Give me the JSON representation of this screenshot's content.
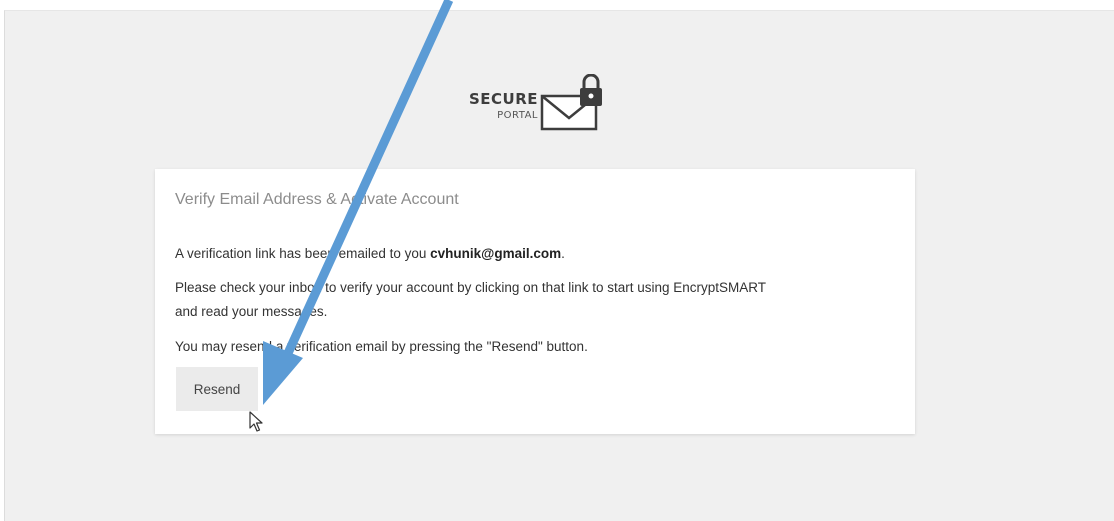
{
  "logo": {
    "word": "SECURE",
    "sub": "PORTAL"
  },
  "card": {
    "title": "Verify Email Address & Activate Account",
    "line1_prefix": "A verification link has been emailed to you ",
    "line1_email": "cvhunik@gmail.com",
    "line1_suffix": ".",
    "line2a": "Please check your inbox to verify your account by clicking on that link to start using EncryptSMART",
    "line2b": "and read your messages.",
    "line3": "You may resend a verification email by pressing the \"Resend\" button.",
    "resend_label": "Resend"
  },
  "icons": {
    "logo": "envelope-lock-icon",
    "cursor": "mouse-pointer-icon",
    "annotation": "annotation-arrow"
  },
  "colors": {
    "arrow": "#5b9bd5",
    "background": "#f0f0f0",
    "card": "#ffffff",
    "button": "#ebebeb"
  }
}
